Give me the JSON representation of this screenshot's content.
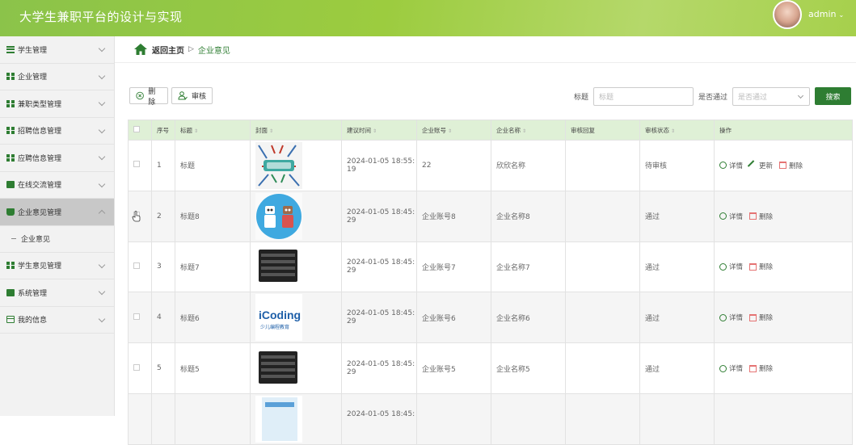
{
  "header": {
    "title": "大学生兼职平台的设计与实现",
    "user": "admin",
    "user_chevron": "⌄"
  },
  "sidebar": {
    "items": [
      {
        "label": "学生管理",
        "icon": "list-icon"
      },
      {
        "label": "企业管理",
        "icon": "grid-icon"
      },
      {
        "label": "兼职类型管理",
        "icon": "grid-icon"
      },
      {
        "label": "招聘信息管理",
        "icon": "grid-icon"
      },
      {
        "label": "应聘信息管理",
        "icon": "grid-icon"
      },
      {
        "label": "在线交流管理",
        "icon": "briefcase-icon"
      },
      {
        "label": "企业意见管理",
        "icon": "message-icon",
        "active": true
      },
      {
        "label": "学生意见管理",
        "icon": "grid-icon"
      },
      {
        "label": "系统管理",
        "icon": "document-icon"
      },
      {
        "label": "我的信息",
        "icon": "card-icon"
      }
    ],
    "sub_item": "企业意见"
  },
  "breadcrumb": {
    "home": "返回主页",
    "separator": "▷",
    "current": "企业意见"
  },
  "toolbar": {
    "delete_label": "删除",
    "audit_label": "审核",
    "title_label": "标题",
    "title_placeholder": "标题",
    "pass_label": "是否通过",
    "pass_placeholder": "是否通过",
    "search_label": "搜索"
  },
  "table": {
    "columns": [
      "序号",
      "标题",
      "封面",
      "建议时间",
      "企业账号",
      "企业名称",
      "审核回复",
      "审核状态",
      "操作"
    ],
    "sortable": [
      false,
      true,
      true,
      true,
      true,
      true,
      false,
      true,
      false
    ],
    "rows": [
      {
        "idx": "1",
        "title": "标题",
        "cover": "poster",
        "time_a": "2024-01-05 18:55:",
        "time_b": "19",
        "account": "22",
        "company": "欣欣名称",
        "reply": "",
        "status": "待审核",
        "ops": [
          "详情",
          "更新",
          "删除"
        ]
      },
      {
        "idx": "2",
        "title": "标题8",
        "cover": "robots",
        "time_a": "2024-01-05 18:45:",
        "time_b": "29",
        "account": "企业账号8",
        "company": "企业名称8",
        "reply": "",
        "status": "通过",
        "ops": [
          "详情",
          "删除"
        ]
      },
      {
        "idx": "3",
        "title": "标题7",
        "cover": "device",
        "time_a": "2024-01-05 18:45:",
        "time_b": "29",
        "account": "企业账号7",
        "company": "企业名称7",
        "reply": "",
        "status": "通过",
        "ops": [
          "详情",
          "删除"
        ]
      },
      {
        "idx": "4",
        "title": "标题6",
        "cover": "icoding",
        "time_a": "2024-01-05 18:45:",
        "time_b": "29",
        "account": "企业账号6",
        "company": "企业名称6",
        "reply": "",
        "status": "通过",
        "ops": [
          "详情",
          "删除"
        ]
      },
      {
        "idx": "5",
        "title": "标题5",
        "cover": "device",
        "time_a": "2024-01-05 18:45:",
        "time_b": "29",
        "account": "企业账号5",
        "company": "企业名称5",
        "reply": "",
        "status": "通过",
        "ops": [
          "详情",
          "删除"
        ]
      },
      {
        "idx": "",
        "title": "",
        "cover": "book",
        "time_a": "2024-01-05 18:45:",
        "time_b": "",
        "account": "",
        "company": "",
        "reply": "",
        "status": "",
        "ops": []
      }
    ]
  },
  "colors": {
    "brand": "#2e7d32",
    "header_bg": "#9ccc3f",
    "table_header_bg": "#dff0d6"
  }
}
